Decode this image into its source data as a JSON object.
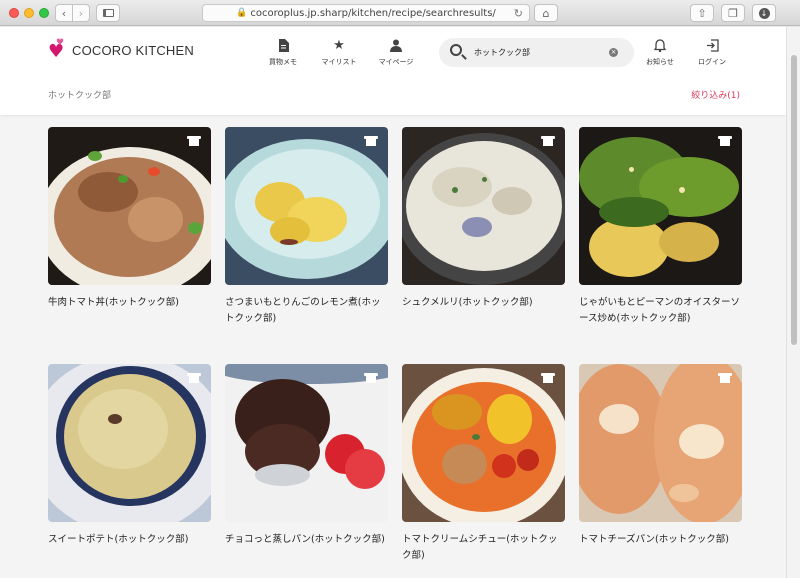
{
  "browser": {
    "url": "cocoroplus.jp.sharp/kitchen/recipe/searchresults/"
  },
  "header": {
    "logo_text": "COCORO KITCHEN",
    "nav": [
      {
        "label": "買物メモ",
        "icon": "memo-icon"
      },
      {
        "label": "マイリスト",
        "icon": "star-icon"
      },
      {
        "label": "マイページ",
        "icon": "user-icon"
      }
    ],
    "search": {
      "value": "ホットクック部"
    },
    "notifications_label": "お知らせ",
    "login_label": "ログイン"
  },
  "breadcrumb": "ホットクック部",
  "filter_label": "絞り込み(1)",
  "recipes": [
    {
      "title": "牛肉トマト丼(ホットクック部)"
    },
    {
      "title": "さつまいもとりんごのレモン煮(ホットクック部)"
    },
    {
      "title": "シュクメルリ(ホットクック部)"
    },
    {
      "title": "じゃがいもとピーマンのオイスターソース炒め(ホットクック部)"
    },
    {
      "title": "スイートポテト(ホットクック部)"
    },
    {
      "title": "チョコっと蒸しパン(ホットクック部)"
    },
    {
      "title": "トマトクリームシチュー(ホットクック部)"
    },
    {
      "title": "トマトチーズパン(ホットクック部)"
    }
  ],
  "colors": {
    "brand": "#d4166f",
    "filter": "#e03a5a"
  }
}
